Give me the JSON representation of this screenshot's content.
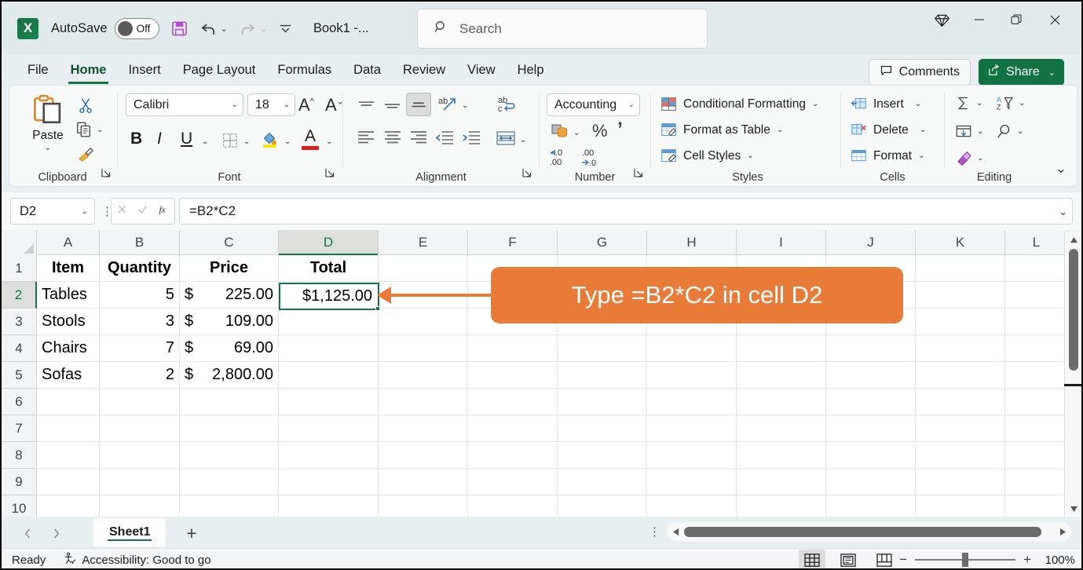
{
  "titlebar": {
    "app_logo": "excel-logo",
    "logo_letter": "X",
    "autosave_label": "AutoSave",
    "autosave_state": "Off",
    "save_icon": "save-icon",
    "undo_icon": "undo-icon",
    "redo_icon": "redo-icon",
    "customize_icon": "customize-quick-access-icon",
    "document_title": "Book1  -...",
    "diamond_icon": "diamond-icon",
    "minimize_icon": "minimize-icon",
    "restore_icon": "restore-icon",
    "close_icon": "close-icon"
  },
  "search": {
    "placeholder": "Search",
    "icon": "search-icon"
  },
  "tabs": [
    {
      "label": "File",
      "active": false
    },
    {
      "label": "Home",
      "active": true
    },
    {
      "label": "Insert",
      "active": false
    },
    {
      "label": "Page Layout",
      "active": false
    },
    {
      "label": "Formulas",
      "active": false
    },
    {
      "label": "Data",
      "active": false
    },
    {
      "label": "Review",
      "active": false
    },
    {
      "label": "View",
      "active": false
    },
    {
      "label": "Help",
      "active": false
    }
  ],
  "header_actions": {
    "comments_label": "Comments",
    "comments_icon": "comment-bubble-icon",
    "share_label": "Share",
    "share_icon": "share-icon",
    "share_color": "#127243"
  },
  "ribbon": {
    "groups": [
      {
        "name": "Clipboard",
        "label": "Clipboard",
        "paste_label": "Paste",
        "cut_icon": "scissors-icon",
        "copy_icon": "copy-icon",
        "format_painter_icon": "format-painter-icon",
        "launcher_icon": "dialog-launcher-icon"
      },
      {
        "name": "Font",
        "label": "Font",
        "font_name": "Calibri",
        "font_size": "18",
        "grow_font_icon": "increase-font-size-icon",
        "shrink_font_icon": "decrease-font-size-icon",
        "bold": "B",
        "italic": "I",
        "underline": "U",
        "borders_icon": "borders-icon",
        "fill_color_icon": "fill-color-icon",
        "font_color_icon": "font-color-icon",
        "launcher_icon": "dialog-launcher-icon"
      },
      {
        "name": "Alignment",
        "label": "Alignment",
        "top_align_icon": "align-top-icon",
        "middle_align_icon": "align-middle-icon",
        "bottom_align_icon": "align-bottom-icon",
        "orientation_icon": "text-orientation-icon",
        "wrap_text_icon": "wrap-text-icon",
        "align_left_icon": "align-left-icon",
        "align_center_icon": "align-center-icon",
        "align_right_icon": "align-right-icon",
        "decrease_indent_icon": "decrease-indent-icon",
        "increase_indent_icon": "increase-indent-icon",
        "merge_cells_icon": "merge-and-center-icon",
        "launcher_icon": "dialog-launcher-icon"
      },
      {
        "name": "Number",
        "label": "Number",
        "number_format": "Accounting",
        "accounting_icon": "accounting-number-format-icon",
        "percent_label": "%",
        "comma_label": "’",
        "decrease_decimal_icon": "decrease-decimal-icon",
        "increase_decimal_icon": "increase-decimal-icon",
        "launcher_icon": "dialog-launcher-icon"
      },
      {
        "name": "Styles",
        "label": "Styles",
        "items": [
          {
            "label": "Conditional Formatting",
            "icon": "conditional-formatting-icon"
          },
          {
            "label": "Format as Table",
            "icon": "format-as-table-icon"
          },
          {
            "label": "Cell Styles",
            "icon": "cell-styles-icon"
          }
        ]
      },
      {
        "name": "Cells",
        "label": "Cells",
        "items": [
          {
            "label": "Insert",
            "icon": "insert-cells-icon"
          },
          {
            "label": "Delete",
            "icon": "delete-cells-icon"
          },
          {
            "label": "Format",
            "icon": "format-cells-icon"
          }
        ]
      },
      {
        "name": "Editing",
        "label": "Editing",
        "autosum_icon": "autosum-icon",
        "sort_filter_icon": "sort-and-filter-icon",
        "fill_icon": "fill-icon",
        "find_select_icon": "find-and-select-icon",
        "clear_icon": "clear-icon",
        "collapse_icon": "collapse-ribbon-icon"
      }
    ]
  },
  "formula_bar": {
    "name_box_value": "D2",
    "cancel_icon": "cancel-icon",
    "enter_icon": "enter-icon",
    "function_icon": "insert-function-icon",
    "formula_value": "=B2*C2",
    "expand_icon": "expand-formula-bar-icon"
  },
  "grid": {
    "columns": [
      "A",
      "B",
      "C",
      "D",
      "E",
      "F",
      "G",
      "H",
      "I",
      "J",
      "K",
      "L"
    ],
    "selected_column": "D",
    "rows": [
      "1",
      "2",
      "3",
      "4",
      "5",
      "6",
      "7",
      "8",
      "9",
      "10"
    ],
    "selected_row": "2",
    "selected_cell": "D2",
    "selected_cell_display": "$1,125.00",
    "data": [
      {
        "row": "1",
        "A": "Item",
        "B": "Quantity",
        "C_currency": "",
        "C_value": "Price",
        "D": "Total",
        "header": true
      },
      {
        "row": "2",
        "A": "Tables",
        "B": "5",
        "C_currency": "$",
        "C_value": "225.00",
        "D": "$1,125.00",
        "header": false
      },
      {
        "row": "3",
        "A": "Stools",
        "B": "3",
        "C_currency": "$",
        "C_value": "109.00",
        "D": "",
        "header": false
      },
      {
        "row": "4",
        "A": "Chairs",
        "B": "7",
        "C_currency": "$",
        "C_value": "69.00",
        "D": "",
        "header": false
      },
      {
        "row": "5",
        "A": "Sofas",
        "B": "2",
        "C_currency": "$",
        "C_value": "2,800.00",
        "D": "",
        "header": false
      }
    ]
  },
  "callout": {
    "text": "Type =B2*C2 in cell D2",
    "color": "#e87b38",
    "arrow_icon": "callout-arrow-icon"
  },
  "sheet_tabs": {
    "prev_icon": "previous-sheet-icon",
    "next_icon": "next-sheet-icon",
    "sheets": [
      {
        "label": "Sheet1",
        "active": true
      }
    ],
    "add_sheet_icon": "add-sheet-icon",
    "options_icon": "sheet-options-icon",
    "hscroll_left_icon": "scroll-left-icon",
    "hscroll_right_icon": "scroll-right-icon"
  },
  "status_bar": {
    "status": "Ready",
    "accessibility": "Accessibility: Good to go",
    "accessibility_icon": "accessibility-icon",
    "views": [
      {
        "name": "normal-view",
        "icon": "normal-view-icon",
        "active": true
      },
      {
        "name": "page-layout-view",
        "icon": "page-layout-view-icon",
        "active": false
      },
      {
        "name": "page-break-preview",
        "icon": "page-break-preview-icon",
        "active": false
      }
    ],
    "zoom_out_label": "−",
    "zoom_in_label": "+",
    "zoom_percent": "100%"
  }
}
